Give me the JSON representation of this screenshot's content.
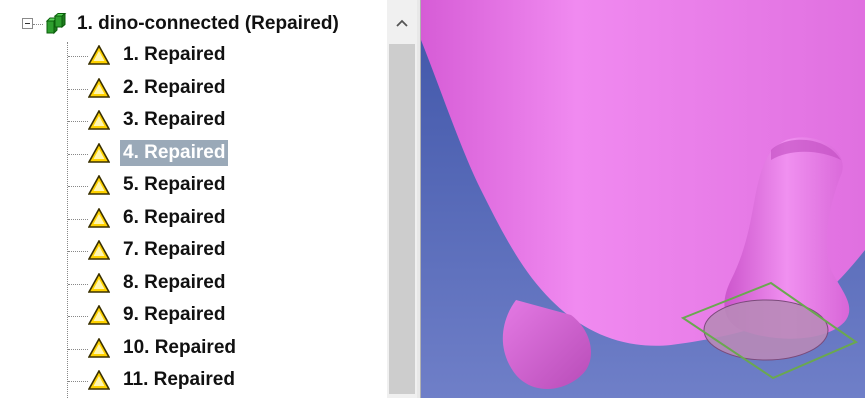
{
  "tree": {
    "root": {
      "label": "1. dino-connected (Repaired)",
      "icon": "green-parts-icon",
      "expanded": true
    },
    "items": [
      {
        "label": "1. Repaired",
        "icon": "warning-icon",
        "selected": false
      },
      {
        "label": "2. Repaired",
        "icon": "warning-icon",
        "selected": false
      },
      {
        "label": "3. Repaired",
        "icon": "warning-icon",
        "selected": false
      },
      {
        "label": "4. Repaired",
        "icon": "warning-icon",
        "selected": true
      },
      {
        "label": "5. Repaired",
        "icon": "warning-icon",
        "selected": false
      },
      {
        "label": "6. Repaired",
        "icon": "warning-icon",
        "selected": false
      },
      {
        "label": "7. Repaired",
        "icon": "warning-icon",
        "selected": false
      },
      {
        "label": "8. Repaired",
        "icon": "warning-icon",
        "selected": false
      },
      {
        "label": "9. Repaired",
        "icon": "warning-icon",
        "selected": false
      },
      {
        "label": "10. Repaired",
        "icon": "warning-icon",
        "selected": false
      },
      {
        "label": "11. Repaired",
        "icon": "warning-icon",
        "selected": false
      }
    ]
  },
  "scrollbar": {
    "up_icon": "chevron-up-icon"
  },
  "viewport": {
    "background_color": "#5a6fbf",
    "mesh_color": "#e878e8",
    "selection_outline_color": "#6aa84f"
  }
}
